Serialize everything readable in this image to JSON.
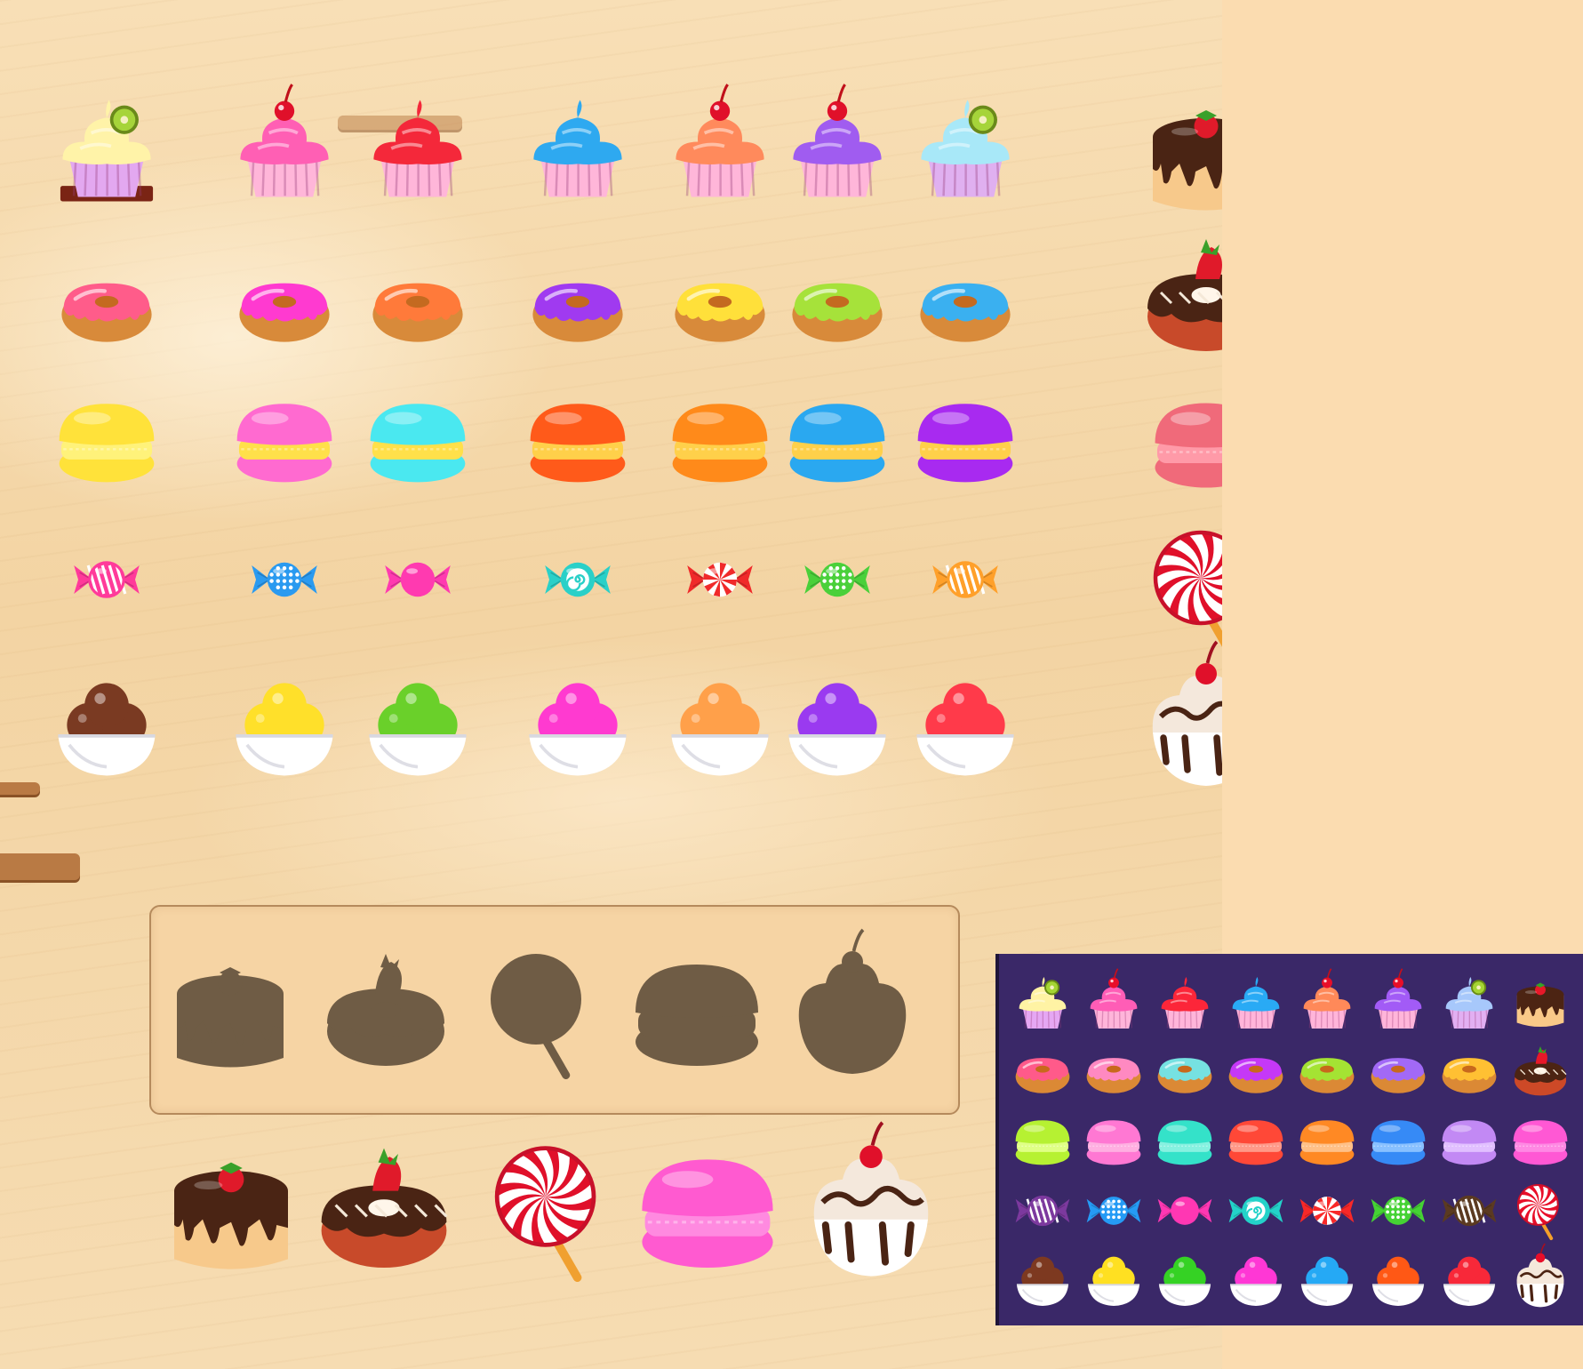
{
  "palette": {
    "preview_bg": "#3a2868",
    "silhouette": "#6f5c45",
    "tray_bg": "#f6d4a4",
    "chocolate": "#4a2414",
    "cream": "#fff6ea"
  },
  "sprite_sheet": {
    "rows": [
      {
        "name": "cupcakes",
        "items": [
          {
            "type": "cupcake",
            "cream": "#fff3a8",
            "wrapper": "#e3a8f0",
            "topping": "kiwi",
            "base": true
          },
          {
            "type": "cupcake",
            "cream": "#ff5fb4",
            "wrapper": "#ffb6d9",
            "topping": "cherry"
          },
          {
            "type": "cupcake",
            "cream": "#f4283a",
            "wrapper": "#ffb6d9",
            "topping": "none"
          },
          {
            "type": "cupcake",
            "cream": "#2ea9f0",
            "wrapper": "#ffb6d9",
            "topping": "none"
          },
          {
            "type": "cupcake",
            "cream": "#ff8a5c",
            "wrapper": "#ffb6d9",
            "topping": "cherry"
          },
          {
            "type": "cupcake",
            "cream": "#a05cf0",
            "wrapper": "#ffb6d9",
            "topping": "cherry"
          },
          {
            "type": "cupcake",
            "cream": "#a8e8f8",
            "wrapper": "#e0b0f0",
            "topping": "kiwi"
          }
        ],
        "special": {
          "type": "cake",
          "glaze": "#4a2414",
          "body": "#f7c98b"
        }
      },
      {
        "name": "donuts",
        "items": [
          {
            "type": "donut",
            "glaze": "#ff5c8a"
          },
          {
            "type": "donut",
            "glaze": "#ff3ad0"
          },
          {
            "type": "donut",
            "glaze": "#ff7a3a"
          },
          {
            "type": "donut",
            "glaze": "#a03af0"
          },
          {
            "type": "donut",
            "glaze": "#ffe03a"
          },
          {
            "type": "donut",
            "glaze": "#a6e23a"
          },
          {
            "type": "donut",
            "glaze": "#3ab0f0"
          }
        ],
        "special": {
          "type": "choco-donut"
        }
      },
      {
        "name": "macarons",
        "items": [
          {
            "type": "macaron",
            "shell": "#ffe23a",
            "fill": "#fff27a"
          },
          {
            "type": "macaron",
            "shell": "#ff6ad0",
            "fill": "#ffe04a"
          },
          {
            "type": "macaron",
            "shell": "#4ae8f0",
            "fill": "#ffe04a"
          },
          {
            "type": "macaron",
            "shell": "#ff5a1a",
            "fill": "#ffd04a"
          },
          {
            "type": "macaron",
            "shell": "#ff8a1a",
            "fill": "#ffd04a"
          },
          {
            "type": "macaron",
            "shell": "#2aa8f0",
            "fill": "#ffd04a"
          },
          {
            "type": "macaron",
            "shell": "#a82af0",
            "fill": "#ffd04a"
          }
        ],
        "special": {
          "type": "macaron",
          "shell": "#f06a7a",
          "fill": "#ff9aa8"
        }
      },
      {
        "name": "candies",
        "items": [
          {
            "type": "candy",
            "color": "#ff3a9a",
            "pattern": "stripes"
          },
          {
            "type": "candy",
            "color": "#2a9af0",
            "pattern": "dots"
          },
          {
            "type": "candy",
            "color": "#ff3ab0",
            "pattern": "plain"
          },
          {
            "type": "candy",
            "color": "#2ad0c8",
            "pattern": "swirl"
          },
          {
            "type": "candy",
            "color": "#f02a2a",
            "pattern": "peppermint"
          },
          {
            "type": "candy",
            "color": "#4ad03a",
            "pattern": "dots"
          },
          {
            "type": "candy",
            "color": "#ffa02a",
            "pattern": "stripes"
          }
        ],
        "special": {
          "type": "lollipop"
        }
      },
      {
        "name": "ice-cream",
        "items": [
          {
            "type": "icecream",
            "scoop": "#7a3a22"
          },
          {
            "type": "icecream",
            "scoop": "#ffe02a"
          },
          {
            "type": "icecream",
            "scoop": "#6ad02a"
          },
          {
            "type": "icecream",
            "scoop": "#ff3ad0"
          },
          {
            "type": "icecream",
            "scoop": "#ffa04a"
          },
          {
            "type": "icecream",
            "scoop": "#9a3af0"
          },
          {
            "type": "icecream",
            "scoop": "#ff3a4a"
          }
        ],
        "special": {
          "type": "sundae"
        }
      }
    ]
  },
  "silhouettes": [
    "cake",
    "choco-donut",
    "lollipop",
    "macaron",
    "sundae"
  ],
  "specials": [
    {
      "type": "cake"
    },
    {
      "type": "choco-donut"
    },
    {
      "type": "lollipop"
    },
    {
      "type": "macaron",
      "shell": "#ff5ad0",
      "fill": "#ff8ae0"
    },
    {
      "type": "sundae"
    }
  ],
  "preview": {
    "rows": [
      {
        "items": [
          {
            "type": "cupcake",
            "cream": "#fff3a8",
            "wrapper": "#e3a8f0",
            "topping": "kiwi"
          },
          {
            "type": "cupcake",
            "cream": "#ff5fb4",
            "wrapper": "#ffb6d9",
            "topping": "cherry"
          },
          {
            "type": "cupcake",
            "cream": "#f4283a",
            "wrapper": "#ffb6d9",
            "topping": "none"
          },
          {
            "type": "cupcake",
            "cream": "#2ea9f0",
            "wrapper": "#ffb6d9",
            "topping": "none"
          },
          {
            "type": "cupcake",
            "cream": "#ff8a5c",
            "wrapper": "#ffb6d9",
            "topping": "cherry"
          },
          {
            "type": "cupcake",
            "cream": "#a05cf0",
            "wrapper": "#ffb6d9",
            "topping": "cherry"
          },
          {
            "type": "cupcake",
            "cream": "#a8c8f8",
            "wrapper": "#e0b0f0",
            "topping": "kiwi"
          },
          {
            "type": "cake"
          }
        ]
      },
      {
        "items": [
          {
            "type": "donut",
            "glaze": "#ff5c8a"
          },
          {
            "type": "donut",
            "glaze": "#ff8ac0"
          },
          {
            "type": "donut",
            "glaze": "#7ae0e0"
          },
          {
            "type": "donut",
            "glaze": "#c03af0"
          },
          {
            "type": "donut",
            "glaze": "#a6e23a"
          },
          {
            "type": "donut",
            "glaze": "#a06af0"
          },
          {
            "type": "donut",
            "glaze": "#ffc03a"
          },
          {
            "type": "choco-donut"
          }
        ]
      },
      {
        "items": [
          {
            "type": "macaron",
            "shell": "#b8f03a",
            "fill": "#e0ff8a"
          },
          {
            "type": "macaron",
            "shell": "#ff7ad0",
            "fill": "#ffb0e0"
          },
          {
            "type": "macaron",
            "shell": "#3ae0c8",
            "fill": "#8af0e0"
          },
          {
            "type": "macaron",
            "shell": "#ff4a3a",
            "fill": "#ff9a8a"
          },
          {
            "type": "macaron",
            "shell": "#ff8a2a",
            "fill": "#ffc08a"
          },
          {
            "type": "macaron",
            "shell": "#3a8af0",
            "fill": "#8ac0ff"
          },
          {
            "type": "macaron",
            "shell": "#c08af0",
            "fill": "#e0c0ff"
          },
          {
            "type": "macaron",
            "shell": "#ff5ad0",
            "fill": "#ff8ae0"
          }
        ]
      },
      {
        "items": [
          {
            "type": "candy",
            "color": "#7a3a9a",
            "pattern": "stripes"
          },
          {
            "type": "candy",
            "color": "#2a9af0",
            "pattern": "dots"
          },
          {
            "type": "candy",
            "color": "#ff3ab0",
            "pattern": "plain"
          },
          {
            "type": "candy",
            "color": "#2ad0c8",
            "pattern": "swirl"
          },
          {
            "type": "candy",
            "color": "#f02a2a",
            "pattern": "peppermint"
          },
          {
            "type": "candy",
            "color": "#4ad03a",
            "pattern": "dots"
          },
          {
            "type": "candy",
            "color": "#5a3a22",
            "pattern": "stripes"
          },
          {
            "type": "lollipop"
          }
        ]
      },
      {
        "items": [
          {
            "type": "icecream",
            "scoop": "#7a3a22"
          },
          {
            "type": "icecream",
            "scoop": "#ffe02a"
          },
          {
            "type": "icecream",
            "scoop": "#3ad02a"
          },
          {
            "type": "icecream",
            "scoop": "#ff3ad0"
          },
          {
            "type": "icecream",
            "scoop": "#2aa8f0"
          },
          {
            "type": "icecream",
            "scoop": "#ff5a1a"
          },
          {
            "type": "icecream",
            "scoop": "#f02a3a"
          },
          {
            "type": "sundae"
          }
        ]
      }
    ]
  }
}
